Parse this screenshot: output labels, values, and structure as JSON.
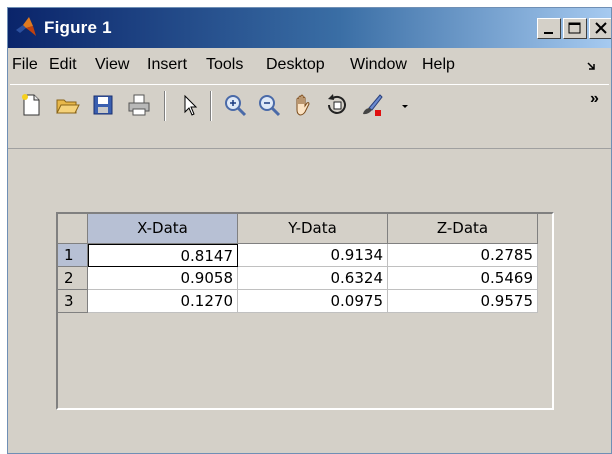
{
  "window": {
    "title": "Figure 1",
    "app_icon": "matlab-logo-icon",
    "buttons": [
      "minimize-icon",
      "maximize-icon",
      "close-icon"
    ]
  },
  "menubar": {
    "items": [
      "File",
      "Edit",
      "View",
      "Insert",
      "Tools",
      "Desktop",
      "Window",
      "Help"
    ],
    "overflow_icon": "menu-overflow-arrow-icon"
  },
  "toolbar": {
    "tools": [
      "new-figure-icon",
      "open-file-icon",
      "save-icon",
      "print-icon",
      "pointer-arrow-icon",
      "zoom-in-icon",
      "zoom-out-icon",
      "pan-hand-icon",
      "rotate-3d-icon",
      "data-brush-icon",
      "chevron-down-icon"
    ],
    "overflow": "»"
  },
  "table": {
    "columns": [
      "X-Data",
      "Y-Data",
      "Z-Data"
    ],
    "row_headers": [
      "1",
      "2",
      "3"
    ],
    "rows": [
      [
        "0.8147",
        "0.9134",
        "0.2785"
      ],
      [
        "0.9058",
        "0.6324",
        "0.5469"
      ],
      [
        "0.1270",
        "0.0975",
        "0.9575"
      ]
    ],
    "selected_column": 0,
    "selected_row": 0
  },
  "colors": {
    "title_gradient_start": "#0a246a",
    "title_gradient_end": "#a6caf0",
    "face": "#d4d0c8",
    "header_selected": "#b7c0d4"
  }
}
